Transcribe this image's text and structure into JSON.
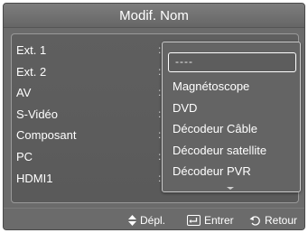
{
  "title": "Modif. Nom",
  "sources": [
    {
      "label": "Ext. 1",
      "sep": ":"
    },
    {
      "label": "Ext. 2",
      "sep": ":"
    },
    {
      "label": "AV",
      "sep": ":"
    },
    {
      "label": "S-Vidéo",
      "sep": ":"
    },
    {
      "label": "Composant",
      "sep": ":"
    },
    {
      "label": "PC",
      "sep": ":"
    },
    {
      "label": "HDMI1",
      "sep": ":"
    }
  ],
  "dropdown": {
    "selected_value": "----",
    "options": [
      "Magnétoscope",
      "DVD",
      "Décodeur Câble",
      "Décodeur satellite",
      "Décodeur PVR"
    ],
    "more_indicator_icon": "scroll-down-arrow-icon"
  },
  "footer": {
    "move_label": "Dépl.",
    "move_icon": "up-down-arrows-icon",
    "enter_label": "Entrer",
    "enter_icon": "enter-icon",
    "return_label": "Retour",
    "return_icon": "return-icon"
  }
}
